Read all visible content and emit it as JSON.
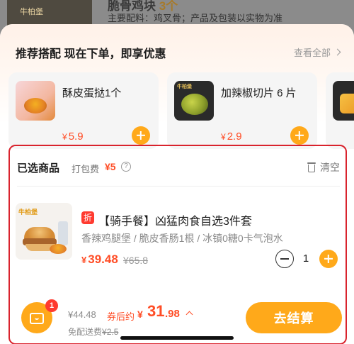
{
  "background": {
    "brand": "牛柏堡",
    "title": "脆骨鸡块",
    "title_accent": "3个",
    "desc": "主要配料：鸡叉骨；产品及包装以实物为准"
  },
  "recommend": {
    "header": "推荐搭配 现在下单，即享优惠",
    "view_all": "查看全部",
    "items": [
      {
        "name": "酥皮蛋挞1个",
        "currency": "¥",
        "price": "5.9",
        "icon": "egg-tart"
      },
      {
        "name": "加辣椒切片 6 片",
        "currency": "¥",
        "price": "2.9",
        "icon": "pepper-slices"
      },
      {
        "name": "",
        "currency": "",
        "price": "",
        "icon": "third-item"
      }
    ],
    "mini_logo": "牛柏堡"
  },
  "selected": {
    "title": "已选商品",
    "pack_fee_label": "打包费",
    "pack_fee_value": "¥5",
    "clear_label": "清空",
    "item": {
      "discount_tag": "折",
      "name": "【骑手餐】凶猛肉食自选3件套",
      "desc": "香辣鸡腿堡 / 脆皮香肠1根 / 冰镇0糖0卡气泡水",
      "currency": "¥",
      "price": "39.48",
      "old_price": "¥65.8",
      "quantity": "1",
      "logo": "牛柏堡"
    }
  },
  "footer": {
    "cart_count": "1",
    "original_total": "¥44.48",
    "after_coupon_label": "券后约",
    "after_coupon_currency": "¥",
    "after_coupon_int": "31",
    "after_coupon_dec": ".98",
    "delivery_label": "免配送费",
    "delivery_old": "¥2.5",
    "checkout_label": "去结算"
  },
  "colors": {
    "accent": "#ffa91a",
    "price_red": "#ff4d26",
    "outline_red": "#d9232d"
  }
}
